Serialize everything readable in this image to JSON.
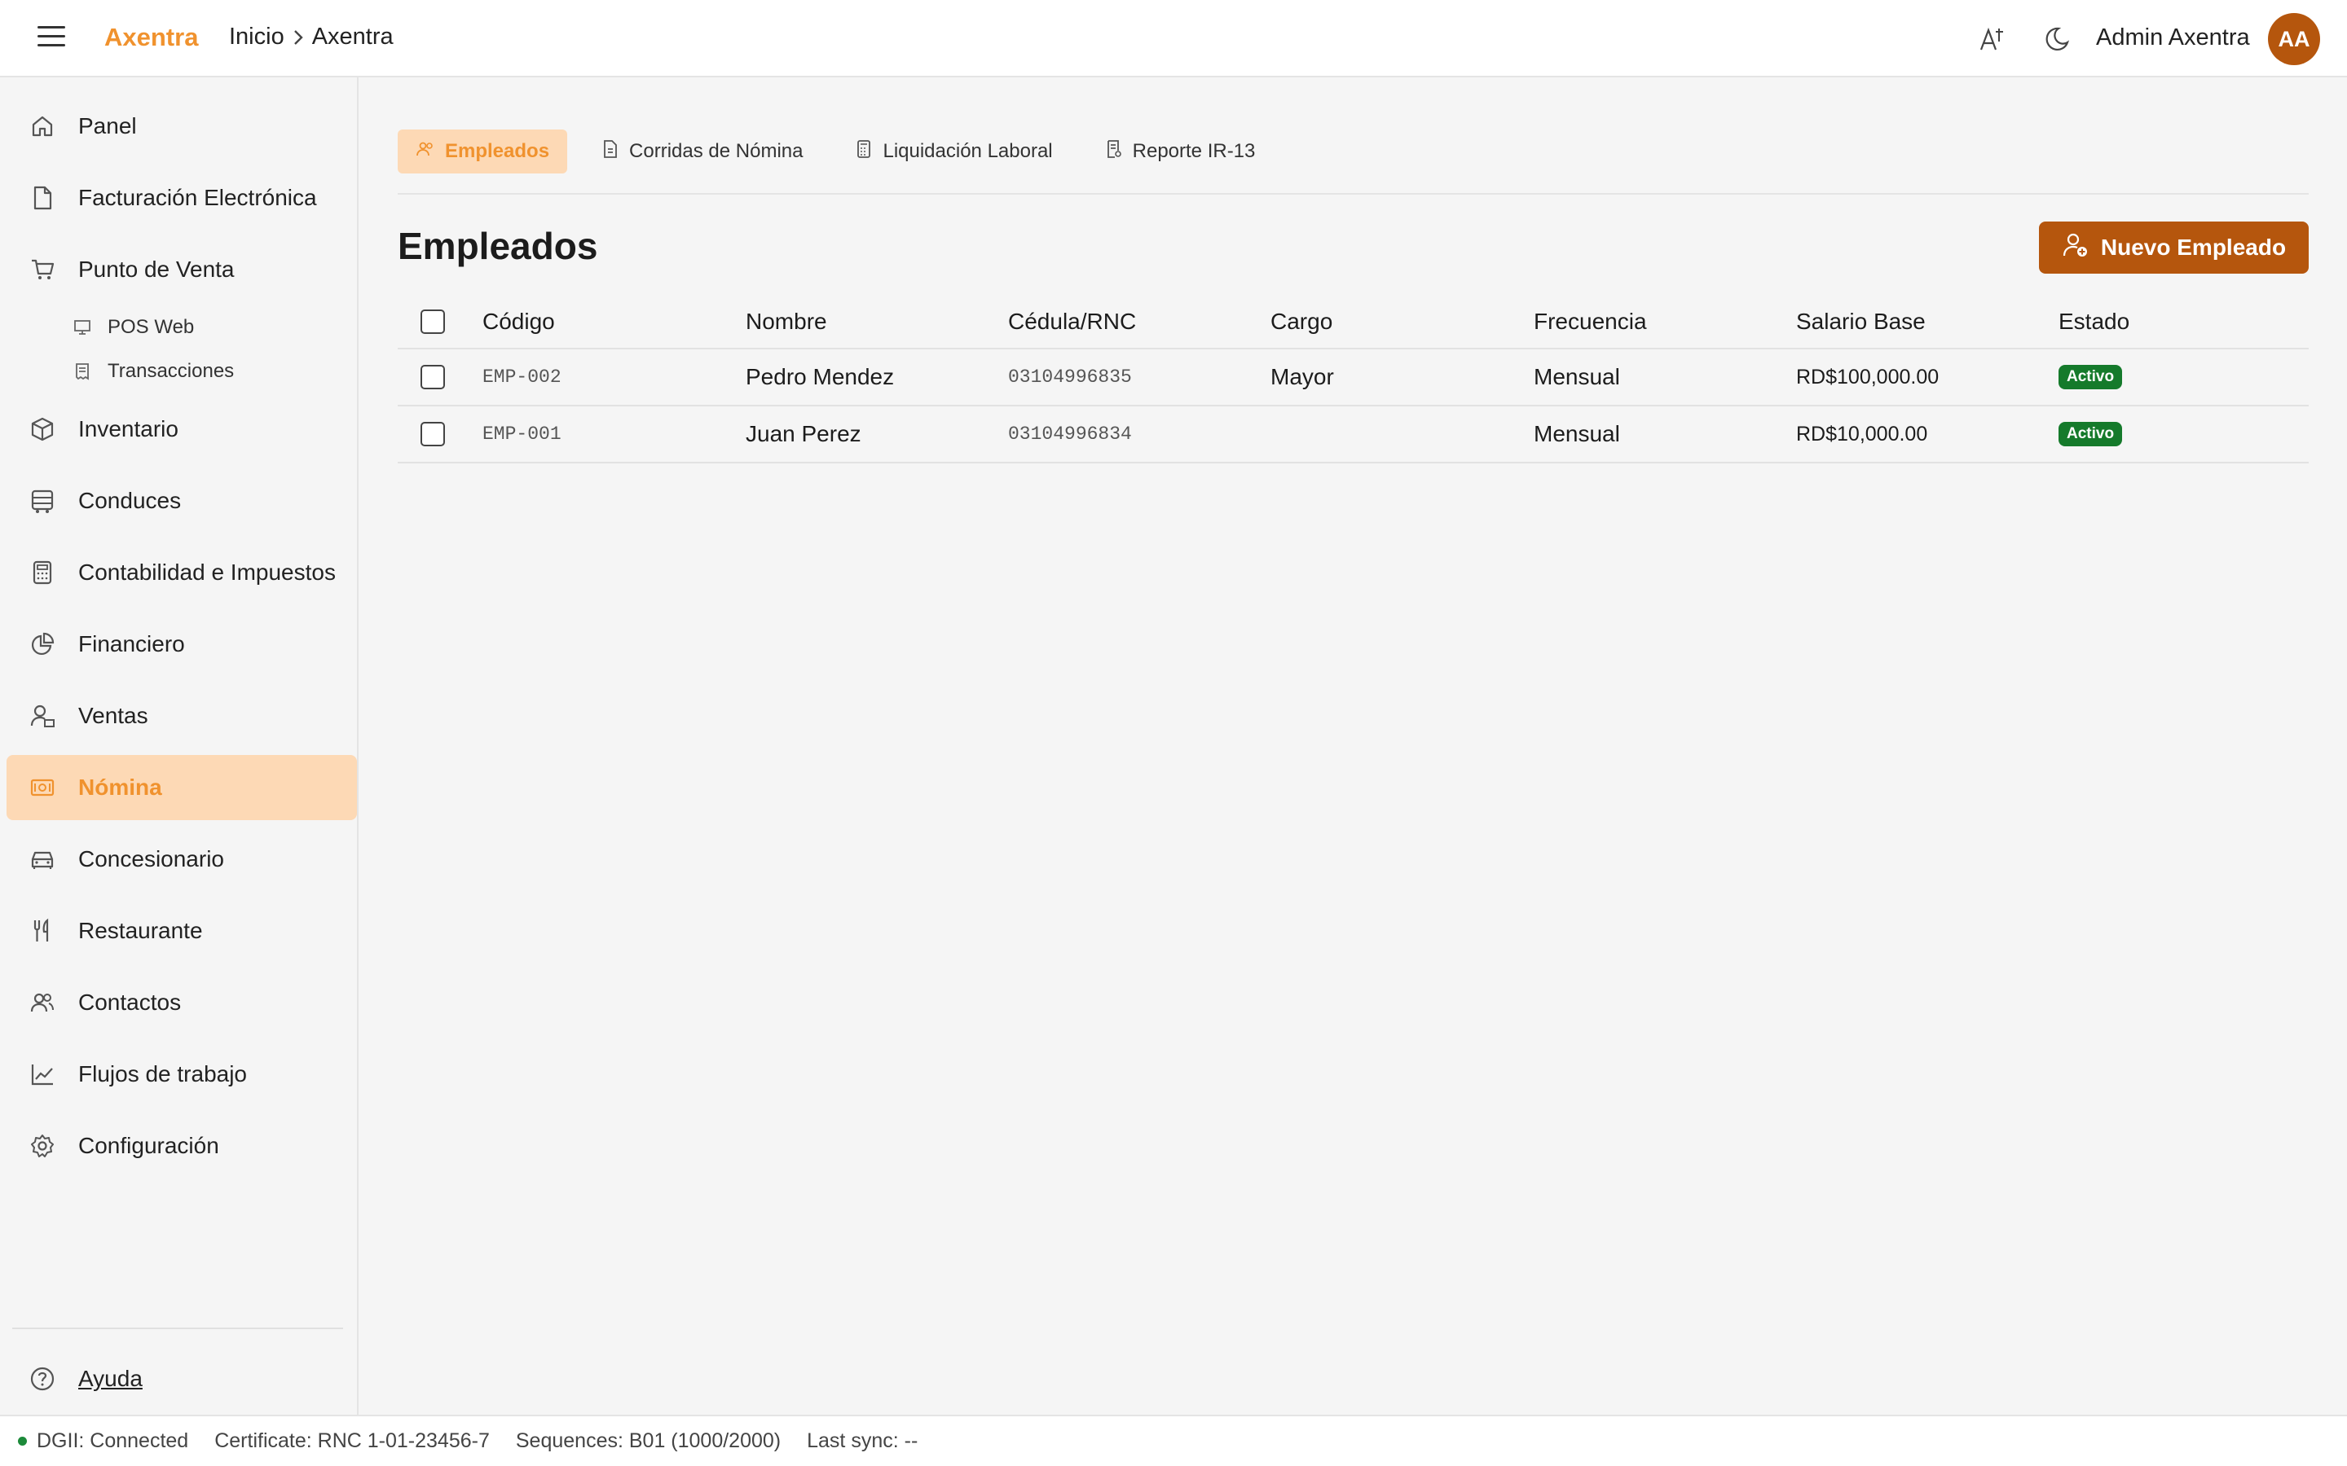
{
  "header": {
    "brand": "Axentra",
    "breadcrumb": [
      "Inicio",
      "Axentra"
    ],
    "user_name": "Admin Axentra",
    "avatar_initials": "AA",
    "icons": [
      "menu-icon",
      "text-size-icon",
      "moon-icon"
    ]
  },
  "sidebar": {
    "items": [
      {
        "label": "Panel",
        "icon": "home-icon"
      },
      {
        "label": "Facturación Electrónica",
        "icon": "file-icon"
      },
      {
        "label": "Punto de Venta",
        "icon": "cart-icon"
      },
      {
        "label": "Inventario",
        "icon": "box-icon"
      },
      {
        "label": "Conduces",
        "icon": "truck-icon"
      },
      {
        "label": "Contabilidad e Impuestos",
        "icon": "calculator-icon"
      },
      {
        "label": "Financiero",
        "icon": "chart-pie-icon"
      },
      {
        "label": "Ventas",
        "icon": "user-sales-icon"
      },
      {
        "label": "Nómina",
        "icon": "payroll-icon",
        "active": true
      },
      {
        "label": "Concesionario",
        "icon": "car-icon"
      },
      {
        "label": "Restaurante",
        "icon": "utensils-icon"
      },
      {
        "label": "Contactos",
        "icon": "users-icon"
      },
      {
        "label": "Flujos de trabajo",
        "icon": "trend-icon"
      },
      {
        "label": "Configuración",
        "icon": "gear-icon"
      }
    ],
    "subitems": [
      {
        "label": "POS Web",
        "icon": "monitor-icon"
      },
      {
        "label": "Transacciones",
        "icon": "receipt-icon"
      }
    ],
    "help_label": "Ayuda"
  },
  "tabs": [
    {
      "label": "Empleados",
      "icon": "users-icon",
      "active": true
    },
    {
      "label": "Corridas de Nómina",
      "icon": "file-text-icon"
    },
    {
      "label": "Liquidación Laboral",
      "icon": "calculator-icon"
    },
    {
      "label": "Reporte IR-13",
      "icon": "report-icon"
    }
  ],
  "page": {
    "title": "Empleados",
    "new_button": "Nuevo Empleado"
  },
  "table": {
    "columns": [
      "Código",
      "Nombre",
      "Cédula/RNC",
      "Cargo",
      "Frecuencia",
      "Salario Base",
      "Estado"
    ],
    "rows": [
      {
        "code": "EMP-002",
        "name": "Pedro Mendez",
        "id": "03104996835",
        "position": "Mayor",
        "frequency": "Mensual",
        "salary": "RD$100,000.00",
        "status": "Activo"
      },
      {
        "code": "EMP-001",
        "name": "Juan Perez",
        "id": "03104996834",
        "position": "",
        "frequency": "Mensual",
        "salary": "RD$10,000.00",
        "status": "Activo"
      }
    ]
  },
  "statusbar": {
    "dgii": "DGII: Connected",
    "certificate": "Certificate: RNC 1-01-23456-7",
    "sequences": "Sequences: B01 (1000/2000)",
    "last_sync": "Last sync: --"
  },
  "colors": {
    "accent": "#f0922e",
    "button": "#b5560d",
    "active_bg": "#fdd9b5",
    "status_active": "#157a2b"
  }
}
